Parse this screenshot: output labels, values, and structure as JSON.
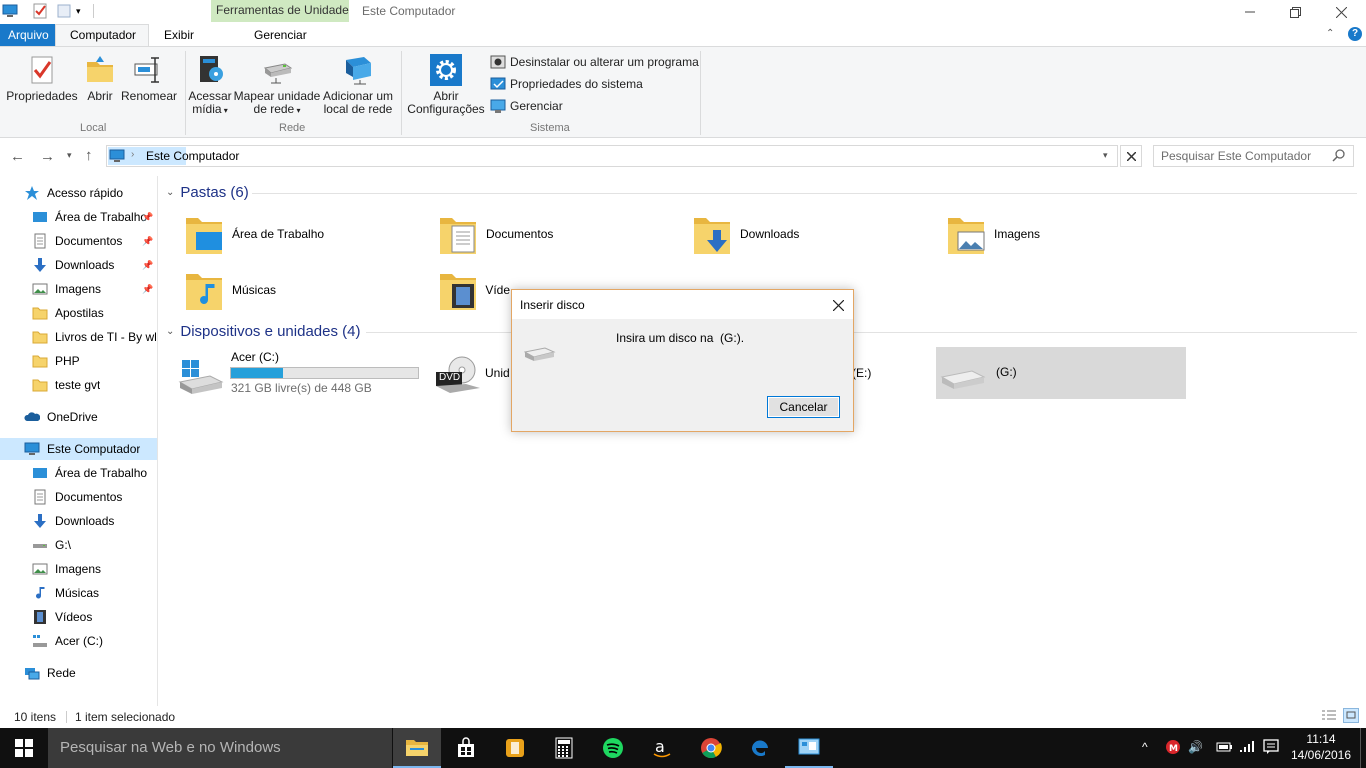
{
  "titlebar": {
    "context_tab": "Ferramentas de Unidade",
    "window_title": "Este Computador"
  },
  "ribbon_tabs": {
    "arquivo": "Arquivo",
    "computador": "Computador",
    "exibir": "Exibir",
    "gerenciar": "Gerenciar"
  },
  "ribbon": {
    "local": {
      "group_label": "Local",
      "propriedades": "Propriedades",
      "abrir": "Abrir",
      "renomear": "Renomear"
    },
    "rede": {
      "group_label": "Rede",
      "acessar_midia_1": "Acessar",
      "acessar_midia_2": "mídia",
      "mapear_1": "Mapear unidade",
      "mapear_2": "de rede",
      "adicionar_1": "Adicionar um",
      "adicionar_2": "local de rede"
    },
    "sistema": {
      "group_label": "Sistema",
      "abrir_config_1": "Abrir",
      "abrir_config_2": "Configurações",
      "desinstalar": "Desinstalar ou alterar um programa",
      "propriedades_sistema": "Propriedades do sistema",
      "gerenciar": "Gerenciar"
    }
  },
  "address": {
    "path": "Este Computador",
    "search_placeholder": "Pesquisar Este Computador"
  },
  "nav": {
    "acesso_rapido": "Acesso rápido",
    "quick": [
      "Área de Trabalho",
      "Documentos",
      "Downloads",
      "Imagens",
      "Apostilas",
      "Livros de TI - By wh",
      "PHP",
      "teste gvt"
    ],
    "onedrive": "OneDrive",
    "este_computador": "Este Computador",
    "pc": [
      "Área de Trabalho",
      "Documentos",
      "Downloads",
      "G:\\",
      "Imagens",
      "Músicas",
      "Vídeos",
      "Acer (C:)"
    ],
    "rede": "Rede"
  },
  "content": {
    "folders_header": "Pastas (6)",
    "folders": [
      "Área de Trabalho",
      "Documentos",
      "Downloads",
      "Imagens",
      "Músicas",
      "Víde"
    ],
    "devices_header": "Dispositivos e unidades (4)",
    "drive_c": {
      "name": "Acer (C:)",
      "free": "321 GB livre(s) de 448 GB",
      "used_fraction": 0.28
    },
    "drive_dvd": {
      "name": "Unid",
      "badge": "DVD"
    },
    "drive_e": {
      "name": "(E:)"
    },
    "drive_g": {
      "name": "(G:)"
    }
  },
  "status": {
    "items": "10 itens",
    "selected": "1 item selecionado"
  },
  "dialog": {
    "title": "Inserir disco",
    "message": "Insira um disco na  (G:).",
    "cancel": "Cancelar"
  },
  "taskbar": {
    "search": "Pesquisar na Web e no Windows",
    "time": "11:14",
    "date": "14/06/2016"
  },
  "colors": {
    "accent": "#1979ca",
    "context_tab": "#cfe9c1",
    "selected_nav": "#cce8ff",
    "drive_bar": "#26a0da"
  }
}
